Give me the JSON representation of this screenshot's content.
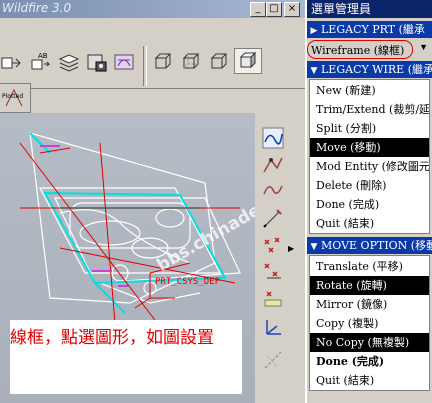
{
  "window": {
    "title": "Wildfire 3.0",
    "minimize": "_",
    "maximize": "□",
    "close": "×"
  },
  "toolbar": {
    "tab_label": "Plotted"
  },
  "graphics": {
    "model_label": "PRT_CSYS_DEF",
    "watermark": "bbs.chinade.net",
    "caption": "線框，點選圖形，如圖設置"
  },
  "menu_manager": {
    "title": "選單管理員",
    "legacy_prt": "LEGACY PRT (繼承",
    "wireframe": "Wireframe (線框)",
    "legacy_wire": {
      "header": "LEGACY WIRE (繼承",
      "items": [
        "New (新建)",
        "Trim/Extend (裁剪/延伸",
        "Split (分割)",
        "Move (移動)",
        "Mod Entity (修改圖元)",
        "Delete (刪除)",
        "Done (完成)",
        "Quit (結束)"
      ]
    },
    "move_option": {
      "header": "MOVE OPTION (移動",
      "items": [
        "Translate (平移)",
        "Rotate (旋轉)",
        "Mirror (鏡像)",
        "Copy (複製)",
        "No Copy (無複製)",
        "Done (完成)",
        "Quit (結束)"
      ]
    }
  },
  "colors": {
    "menu_title": "#0a246a",
    "menu_header": "#0a3aa8",
    "annotation": "#e00000",
    "cyan": "#00e0e0"
  }
}
